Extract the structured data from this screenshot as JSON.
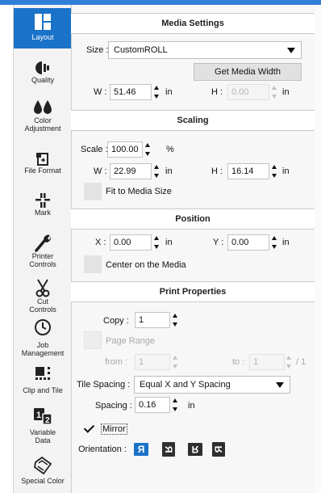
{
  "sidebar": {
    "items": [
      {
        "label": "Layout",
        "icon": "layout-icon"
      },
      {
        "label": "Quality",
        "icon": "quality-icon"
      },
      {
        "label": "Color\nAdjustment",
        "icon": "color-drops-icon"
      },
      {
        "label": "File Format",
        "icon": "file-format-icon"
      },
      {
        "label": "Mark",
        "icon": "crop-mark-icon"
      },
      {
        "label": "Printer\nControls",
        "icon": "wrench-icon"
      },
      {
        "label": "Cut\nControls",
        "icon": "scissors-icon"
      },
      {
        "label": "Job\nManagement",
        "icon": "clock-icon"
      },
      {
        "label": "Clip and Tile",
        "icon": "clip-tile-icon"
      },
      {
        "label": "Variable\nData",
        "icon": "variable-data-icon"
      },
      {
        "label": "Special Color",
        "icon": "special-color-icon"
      }
    ],
    "active": "Layout"
  },
  "media": {
    "title": "Media Settings",
    "size_label": "Size :",
    "size_value": "CustomROLL",
    "get_width_button": "Get Media Width",
    "w_label": "W :",
    "w_value": "51.46",
    "w_unit": "in",
    "h_label": "H :",
    "h_value": "0.00",
    "h_unit": "in"
  },
  "scaling": {
    "title": "Scaling",
    "scale_label": "Scale :",
    "scale_value": "100.00",
    "scale_unit": "%",
    "w_label": "W :",
    "w_value": "22.99",
    "w_unit": "in",
    "h_label": "H :",
    "h_value": "16.14",
    "h_unit": "in",
    "fit_label": "Fit to Media Size",
    "fit_checked": false
  },
  "position": {
    "title": "Position",
    "x_label": "X :",
    "x_value": "0.00",
    "x_unit": "in",
    "y_label": "Y :",
    "y_value": "0.00",
    "y_unit": "in",
    "center_label": "Center on the Media",
    "center_checked": false
  },
  "print": {
    "title": "Print Properties",
    "copy_label": "Copy :",
    "copy_value": "1",
    "page_range_label": "Page Range",
    "from_label": "from :",
    "from_value": "1",
    "to_label": "to :",
    "to_value": "1",
    "to_total": "/ 1",
    "tile_label": "Tile Spacing :",
    "tile_value": "Equal X and Y Spacing",
    "spacing_label": "Spacing :",
    "spacing_value": "0.16",
    "spacing_unit": "in",
    "mirror_label": "Mirror",
    "mirror_checked": true,
    "orientation_label": "Orientation :",
    "orientations": [
      "R",
      "R",
      "R",
      "R"
    ]
  },
  "colors": {
    "accent": "#1a73c9"
  }
}
